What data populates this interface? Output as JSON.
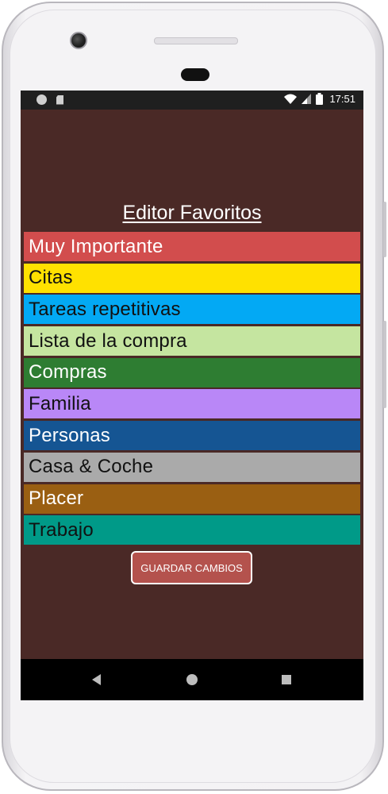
{
  "status_bar": {
    "time": "17:51",
    "left_icons": [
      "notification-dot-icon",
      "sd-card-icon"
    ],
    "right_icons": [
      "wifi-icon",
      "signal-icon",
      "battery-icon"
    ]
  },
  "page": {
    "title": "Editor Favoritos"
  },
  "favorites": [
    {
      "label": "Muy Importante",
      "color": "#d24d4d",
      "text_color": "#ffffff"
    },
    {
      "label": "Citas",
      "color": "#ffe100",
      "text_color": "#111111"
    },
    {
      "label": "Tareas repetitivas",
      "color": "#03a9f4",
      "text_color": "#111111"
    },
    {
      "label": "Lista de la compra",
      "color": "#c5e5a0",
      "text_color": "#111111"
    },
    {
      "label": "Compras",
      "color": "#2e7d32",
      "text_color": "#ffffff"
    },
    {
      "label": "Familia",
      "color": "#b987f7",
      "text_color": "#111111"
    },
    {
      "label": "Personas",
      "color": "#155593",
      "text_color": "#ffffff"
    },
    {
      "label": "Casa & Coche",
      "color": "#aaaaaa",
      "text_color": "#111111"
    },
    {
      "label": "Placer",
      "color": "#9a5f12",
      "text_color": "#ffffff"
    },
    {
      "label": "Trabajo",
      "color": "#009a88",
      "text_color": "#111111"
    }
  ],
  "actions": {
    "save_label": "GUARDAR CAMBIOS"
  },
  "nav_bar": {
    "icons": [
      "back-icon",
      "home-icon",
      "recent-apps-icon"
    ]
  },
  "colors": {
    "background": "#4a2926",
    "button": "#b4524d",
    "status_bar": "#1f1f1f"
  }
}
